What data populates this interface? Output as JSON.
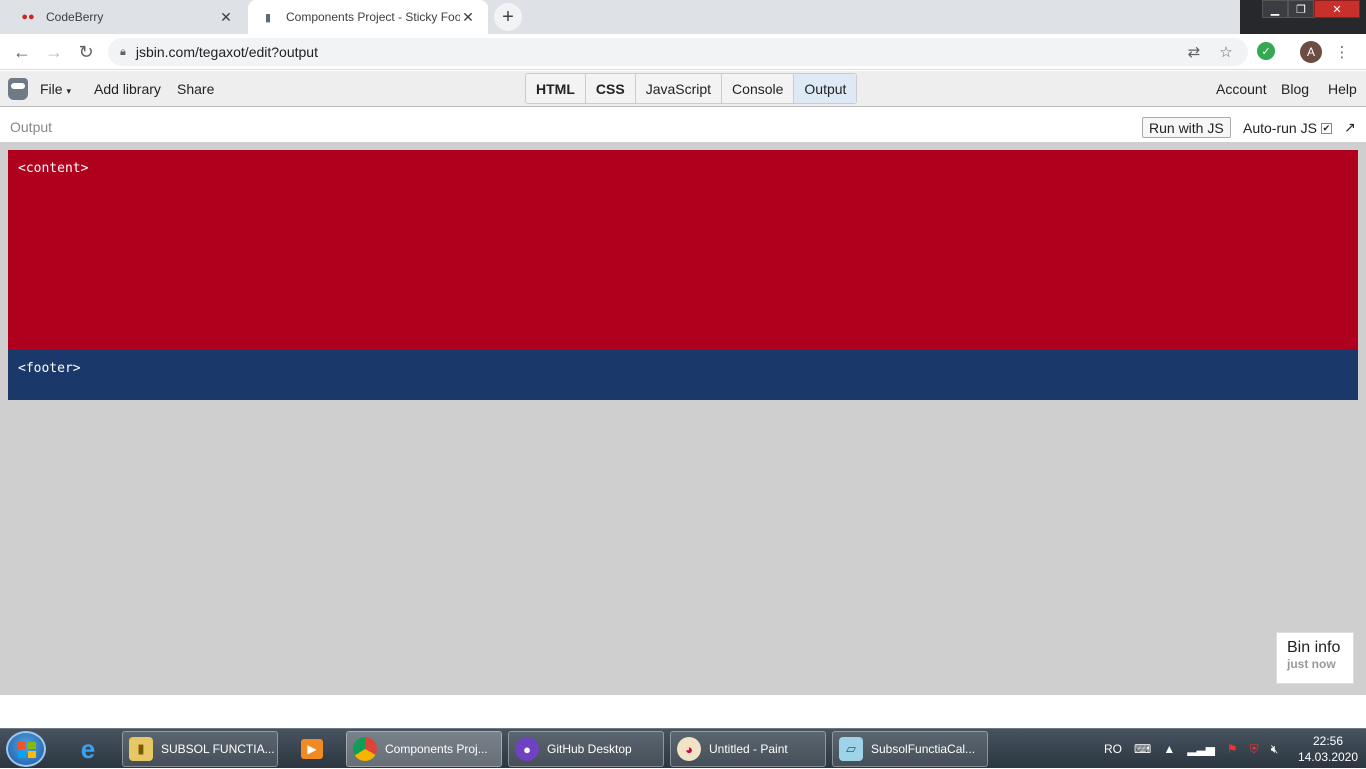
{
  "browser": {
    "tabs": [
      {
        "title": "CodeBerry",
        "icon": "codeberry-icon"
      },
      {
        "title": "Components Project - Sticky Foo",
        "icon": "jsbin-icon"
      }
    ],
    "url": "jsbin.com/tegaxot/edit?output",
    "profile_initial": "A",
    "extension_badge": "0"
  },
  "jsbin": {
    "menu": {
      "file": "File",
      "add_library": "Add library",
      "share": "Share"
    },
    "panels": [
      "HTML",
      "CSS",
      "JavaScript",
      "Console",
      "Output"
    ],
    "right_menu": {
      "account": "Account",
      "blog": "Blog",
      "help": "Help"
    },
    "output_label": "Output",
    "run_button": "Run with JS",
    "autorun_label": "Auto-run JS",
    "autorun_checked": "✔",
    "popout_icon": "↗"
  },
  "output": {
    "content_text": "<content>",
    "footer_text": "<footer>",
    "content_color": "#af001e",
    "footer_color": "#1b386a",
    "bin_info_title": "Bin info",
    "bin_info_sub": "just now"
  },
  "taskbar": {
    "items": [
      {
        "label": "SUBSOL FUNCTIA...",
        "icon": "folder-icon"
      },
      {
        "label": "Components Proj...",
        "icon": "chrome-icon"
      },
      {
        "label": "GitHub Desktop",
        "icon": "github-icon"
      },
      {
        "label": "Untitled - Paint",
        "icon": "paint-icon"
      },
      {
        "label": "SubsolFunctiaCal...",
        "icon": "document-icon"
      }
    ],
    "language": "RO",
    "time": "22:56",
    "date": "14.03.2020"
  }
}
